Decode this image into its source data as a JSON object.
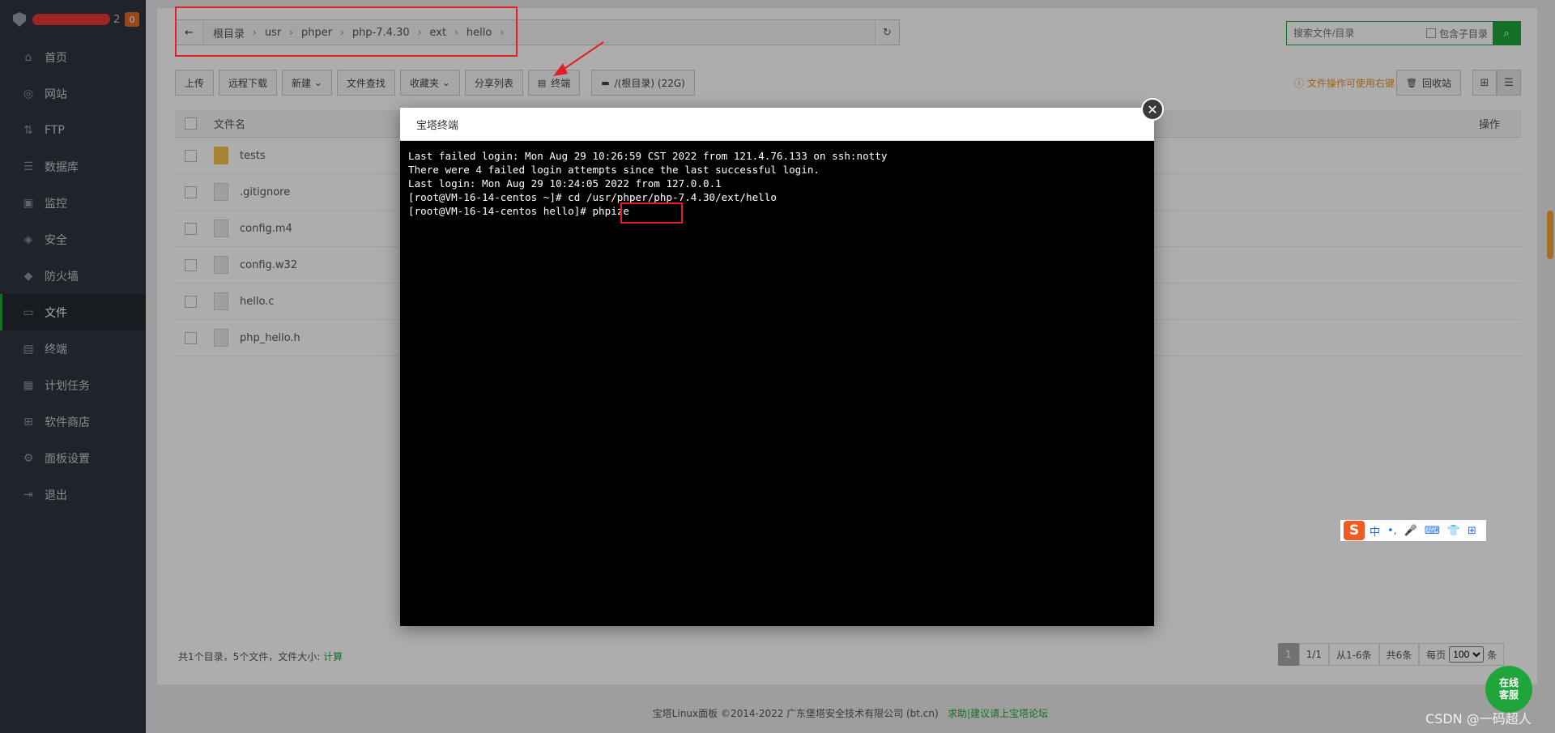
{
  "sidebar": {
    "host_suffix": "2",
    "badge": "0",
    "items": [
      {
        "label": "首页",
        "icon": "home-icon"
      },
      {
        "label": "网站",
        "icon": "globe-icon"
      },
      {
        "label": "FTP",
        "icon": "ftp-icon"
      },
      {
        "label": "数据库",
        "icon": "database-icon"
      },
      {
        "label": "监控",
        "icon": "monitor-icon"
      },
      {
        "label": "安全",
        "icon": "shield-icon"
      },
      {
        "label": "防火墙",
        "icon": "firewall-icon"
      },
      {
        "label": "文件",
        "icon": "folder-icon"
      },
      {
        "label": "终端",
        "icon": "terminal-icon"
      },
      {
        "label": "计划任务",
        "icon": "calendar-icon"
      },
      {
        "label": "软件商店",
        "icon": "apps-icon"
      },
      {
        "label": "面板设置",
        "icon": "gear-icon"
      },
      {
        "label": "退出",
        "icon": "logout-icon"
      }
    ]
  },
  "breadcrumb": [
    "根目录",
    "usr",
    "phper",
    "php-7.4.30",
    "ext",
    "hello"
  ],
  "search": {
    "placeholder": "搜索文件/目录",
    "subdir_label": "包含子目录"
  },
  "toolbar": {
    "upload": "上传",
    "remote_download": "远程下载",
    "new": "新建",
    "file_search": "文件查找",
    "favorites": "收藏夹",
    "share_list": "分享列表",
    "terminal": "终端",
    "disk": "/(根目录) (22G)",
    "tip": "文件操作可使用右键",
    "recycle": "回收站"
  },
  "table": {
    "col_name": "文件名",
    "col_action": "操作",
    "rows": [
      {
        "name": "tests",
        "type": "folder"
      },
      {
        "name": ".gitignore",
        "type": "file"
      },
      {
        "name": "config.m4",
        "type": "file"
      },
      {
        "name": "config.w32",
        "type": "file"
      },
      {
        "name": "hello.c",
        "type": "file"
      },
      {
        "name": "php_hello.h",
        "type": "file"
      }
    ]
  },
  "footer": {
    "summary": "共1个目录，5个文件，文件大小:",
    "calc": "计算",
    "pager": {
      "current": "1",
      "pages": "1/1",
      "range": "从1-6条",
      "total": "共6条",
      "per_page_label": "每页",
      "per_page": "100",
      "unit": "条"
    }
  },
  "copyright": {
    "text": "宝塔Linux面板 ©2014-2022 广东堡塔安全技术有限公司 (bt.cn)",
    "link": "求助|建议请上宝塔论坛"
  },
  "dialog": {
    "title": "宝塔终端",
    "lines": [
      "Last failed login: Mon Aug 29 10:26:59 CST 2022 from 121.4.76.133 on ssh:notty",
      "There were 4 failed login attempts since the last successful login.",
      "Last login: Mon Aug 29 10:24:05 2022 from 127.0.0.1",
      "[root@VM-16-14-centos ~]# cd /usr/phper/php-7.4.30/ext/hello",
      "[root@VM-16-14-centos hello]# phpize"
    ]
  },
  "ime": {
    "lang": "中"
  },
  "online_service": {
    "line1": "在线",
    "line2": "客服"
  },
  "watermark": "CSDN @一码超人"
}
